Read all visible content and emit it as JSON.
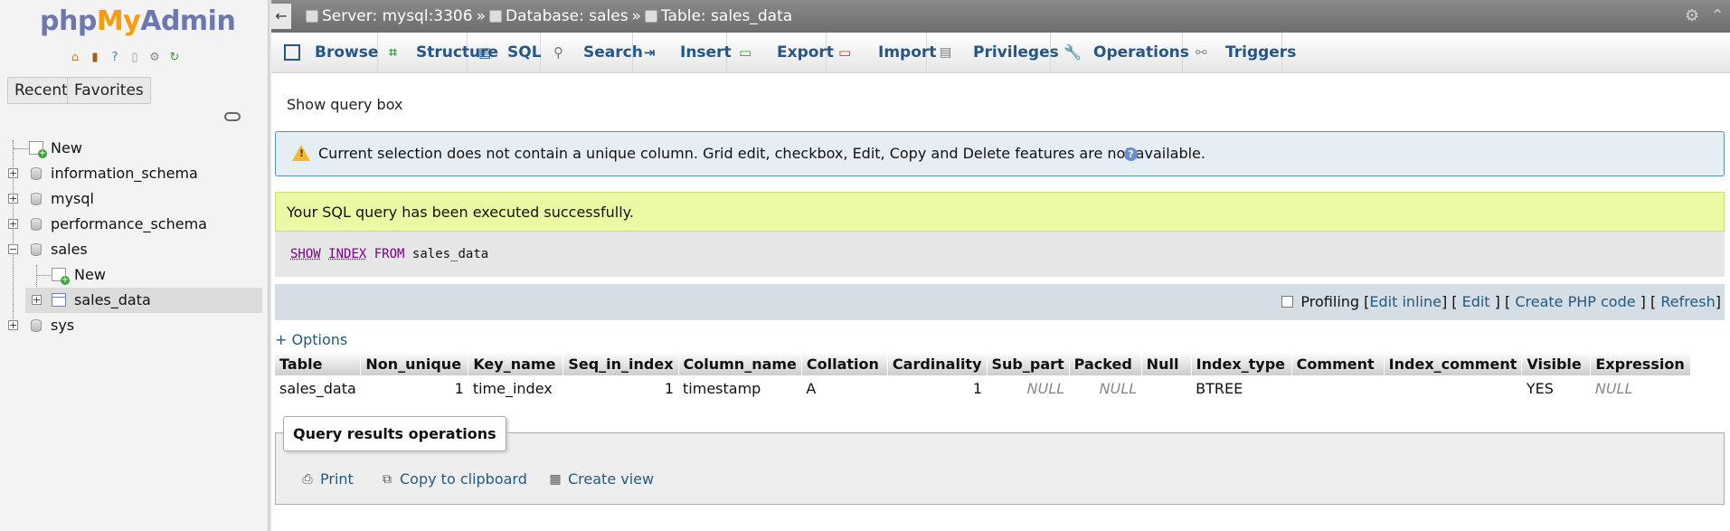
{
  "logo": {
    "php": "php",
    "my": "My",
    "admin": "Admin"
  },
  "left": {
    "recent_label": "Recent",
    "favorites_label": "Favorites",
    "tree": [
      {
        "label": "New"
      },
      {
        "label": "information_schema"
      },
      {
        "label": "mysql"
      },
      {
        "label": "performance_schema"
      },
      {
        "label": "sales"
      },
      {
        "label": "New"
      },
      {
        "label": "sales_data"
      },
      {
        "label": "sys"
      }
    ]
  },
  "breadcrumb": {
    "server": "Server: mysql:3306",
    "database": "Database: sales",
    "table": "Table: sales_data",
    "sep": "»"
  },
  "menu": [
    {
      "label": "Browse",
      "icon": "browse-icon"
    },
    {
      "label": "Structure",
      "icon": "structure-icon"
    },
    {
      "label": "SQL",
      "icon": "sql-icon"
    },
    {
      "label": "Search",
      "icon": "search-icon"
    },
    {
      "label": "Insert",
      "icon": "insert-icon"
    },
    {
      "label": "Export",
      "icon": "export-icon"
    },
    {
      "label": "Import",
      "icon": "import-icon"
    },
    {
      "label": "Privileges",
      "icon": "privileges-icon"
    },
    {
      "label": "Operations",
      "icon": "operations-icon"
    },
    {
      "label": "Triggers",
      "icon": "triggers-icon"
    }
  ],
  "main": {
    "show_query_box": "Show query box",
    "notice": "Current selection does not contain a unique column. Grid edit, checkbox, Edit, Copy and Delete features are not available.",
    "success": "Your SQL query has been executed successfully.",
    "sql": {
      "kw1": "SHOW",
      "kw2": "INDEX",
      "kw3": "FROM",
      "rest": "sales_data"
    },
    "profiling": {
      "label": "Profiling",
      "edit_inline": "Edit inline",
      "edit": "Edit",
      "create_php": "Create PHP code",
      "refresh": "Refresh"
    },
    "options": "+ Options"
  },
  "table": {
    "headers": [
      "Table",
      "Non_unique",
      "Key_name",
      "Seq_in_index",
      "Column_name",
      "Collation",
      "Cardinality",
      "Sub_part",
      "Packed",
      "Null",
      "Index_type",
      "Comment",
      "Index_comment",
      "Visible",
      "Expression"
    ],
    "rows": [
      [
        "sales_data",
        "1",
        "time_index",
        "1",
        "timestamp",
        "A",
        "1",
        "NULL",
        "NULL",
        "",
        "BTREE",
        "",
        "",
        "YES",
        "NULL"
      ]
    ]
  },
  "ops": {
    "legend": "Query results operations",
    "print": "Print",
    "copy": "Copy to clipboard",
    "create_view": "Create view"
  },
  "colors": {
    "link": "#235a81",
    "success_bg": "#ebf8a4",
    "notice_bg": "#e6eef5"
  }
}
